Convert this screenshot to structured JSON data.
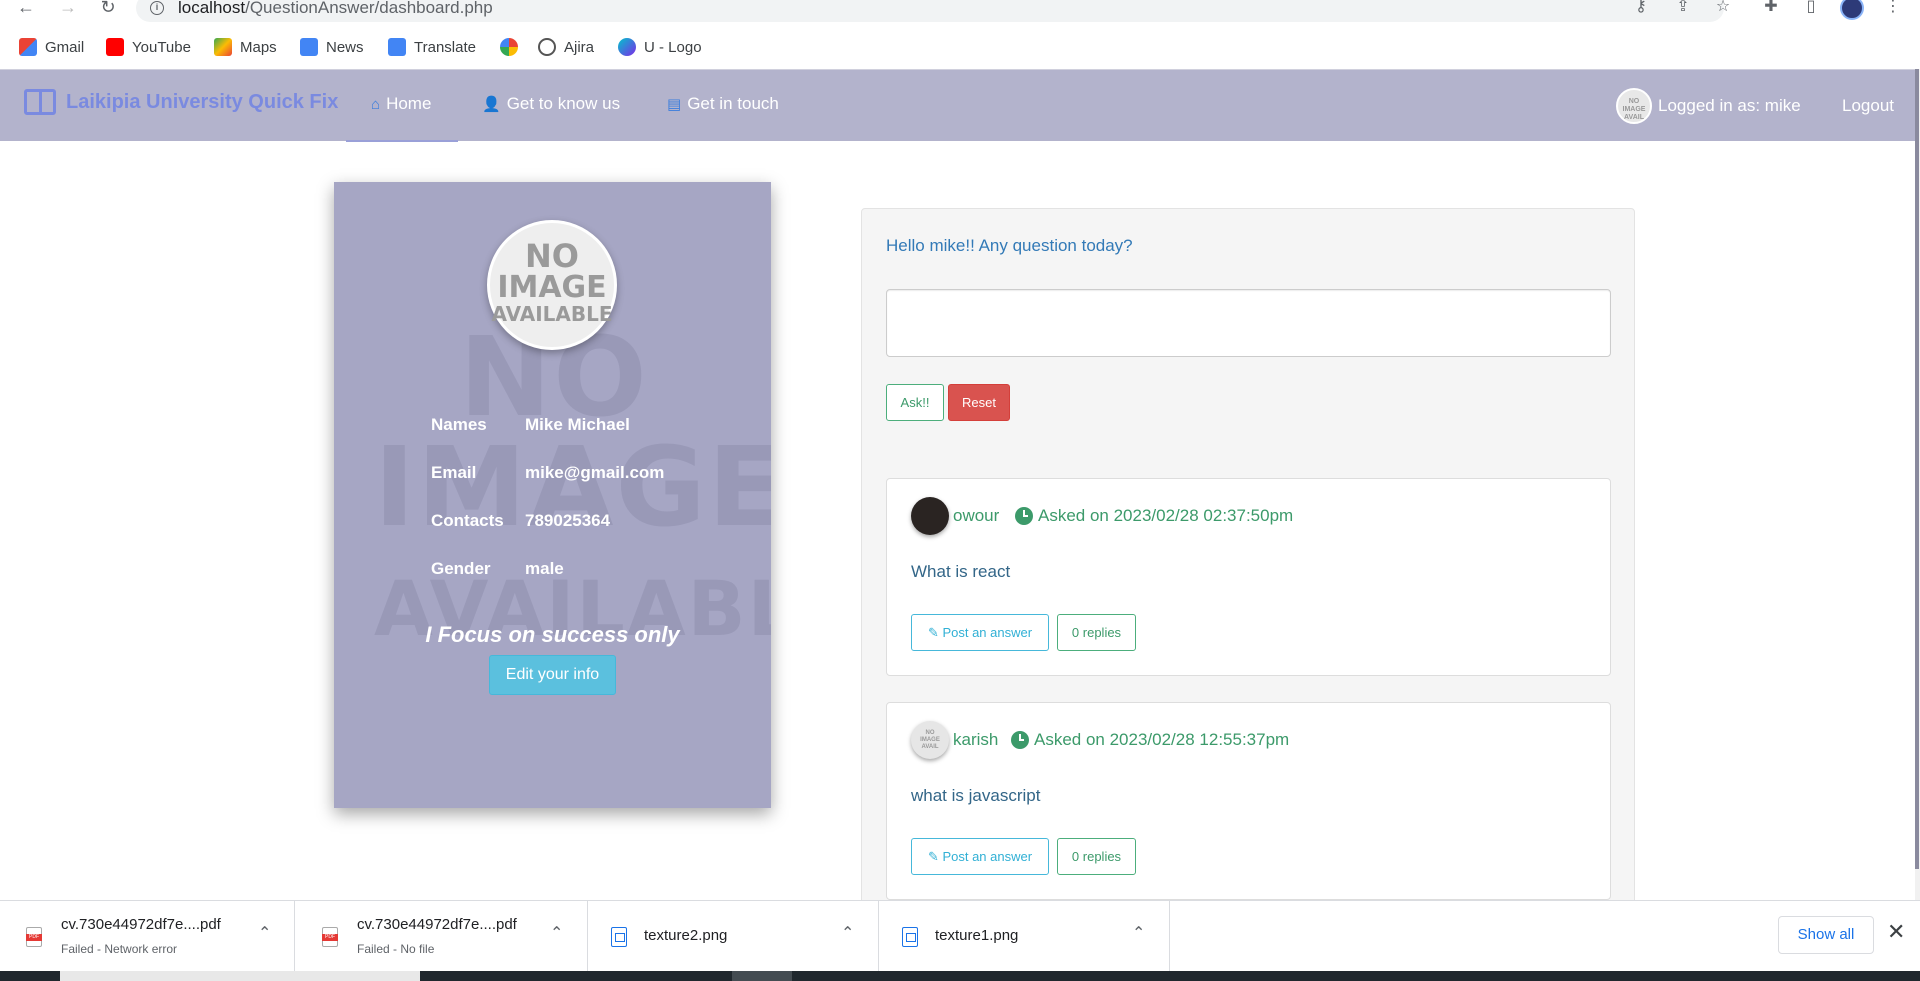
{
  "browser": {
    "url_host": "localhost",
    "url_path": "/QuestionAnswer/dashboard.php",
    "bookmarks": [
      "Gmail",
      "YouTube",
      "Maps",
      "News",
      "Translate",
      "",
      "Ajira",
      "U - Logo"
    ]
  },
  "navbar": {
    "brand": "Laikipia University Quick Fix",
    "links": [
      "Home",
      "Get to know us",
      "Get in touch"
    ],
    "user_label": "Logged in as: mike",
    "logout": "Logout"
  },
  "profile": {
    "avatar_text": [
      "NO",
      "IMAGE",
      "AVAILABLE"
    ],
    "rows": [
      {
        "key": "Names",
        "value": "Mike Michael"
      },
      {
        "key": "Email",
        "value": "mike@gmail.com"
      },
      {
        "key": "Contacts",
        "value": "789025364"
      },
      {
        "key": "Gender",
        "value": "male"
      }
    ],
    "motto": "I Focus on success only",
    "edit_button": "Edit your info"
  },
  "questions": {
    "greeting": "Hello mike!! Any question today?",
    "ask_button": "Ask!!",
    "reset_button": "Reset",
    "items": [
      {
        "author": "owour",
        "asked": "Asked on 2023/02/28 02:37:50pm",
        "text": "What is react",
        "post_answer": "Post an answer",
        "replies": "0 replies"
      },
      {
        "author": "karish",
        "asked": "Asked on 2023/02/28 12:55:37pm",
        "text": "what is javascript",
        "post_answer": "Post an answer",
        "replies": "0 replies"
      }
    ]
  },
  "downloads": {
    "items": [
      {
        "name": "cv.730e44972df7e....pdf",
        "status": "Failed - Network error"
      },
      {
        "name": "cv.730e44972df7e....pdf",
        "status": "Failed - No file"
      },
      {
        "name": "texture2.png",
        "status": ""
      },
      {
        "name": "texture1.png",
        "status": ""
      }
    ],
    "show_all": "Show all"
  },
  "colors": {
    "navbar_bg": "#b3b3cc",
    "card_bg": "#a6a6c4",
    "accent_green": "#3c9a6a",
    "accent_blue": "#337ab7",
    "reset_red": "#d9534f",
    "edit_cyan": "#5bc0de"
  }
}
